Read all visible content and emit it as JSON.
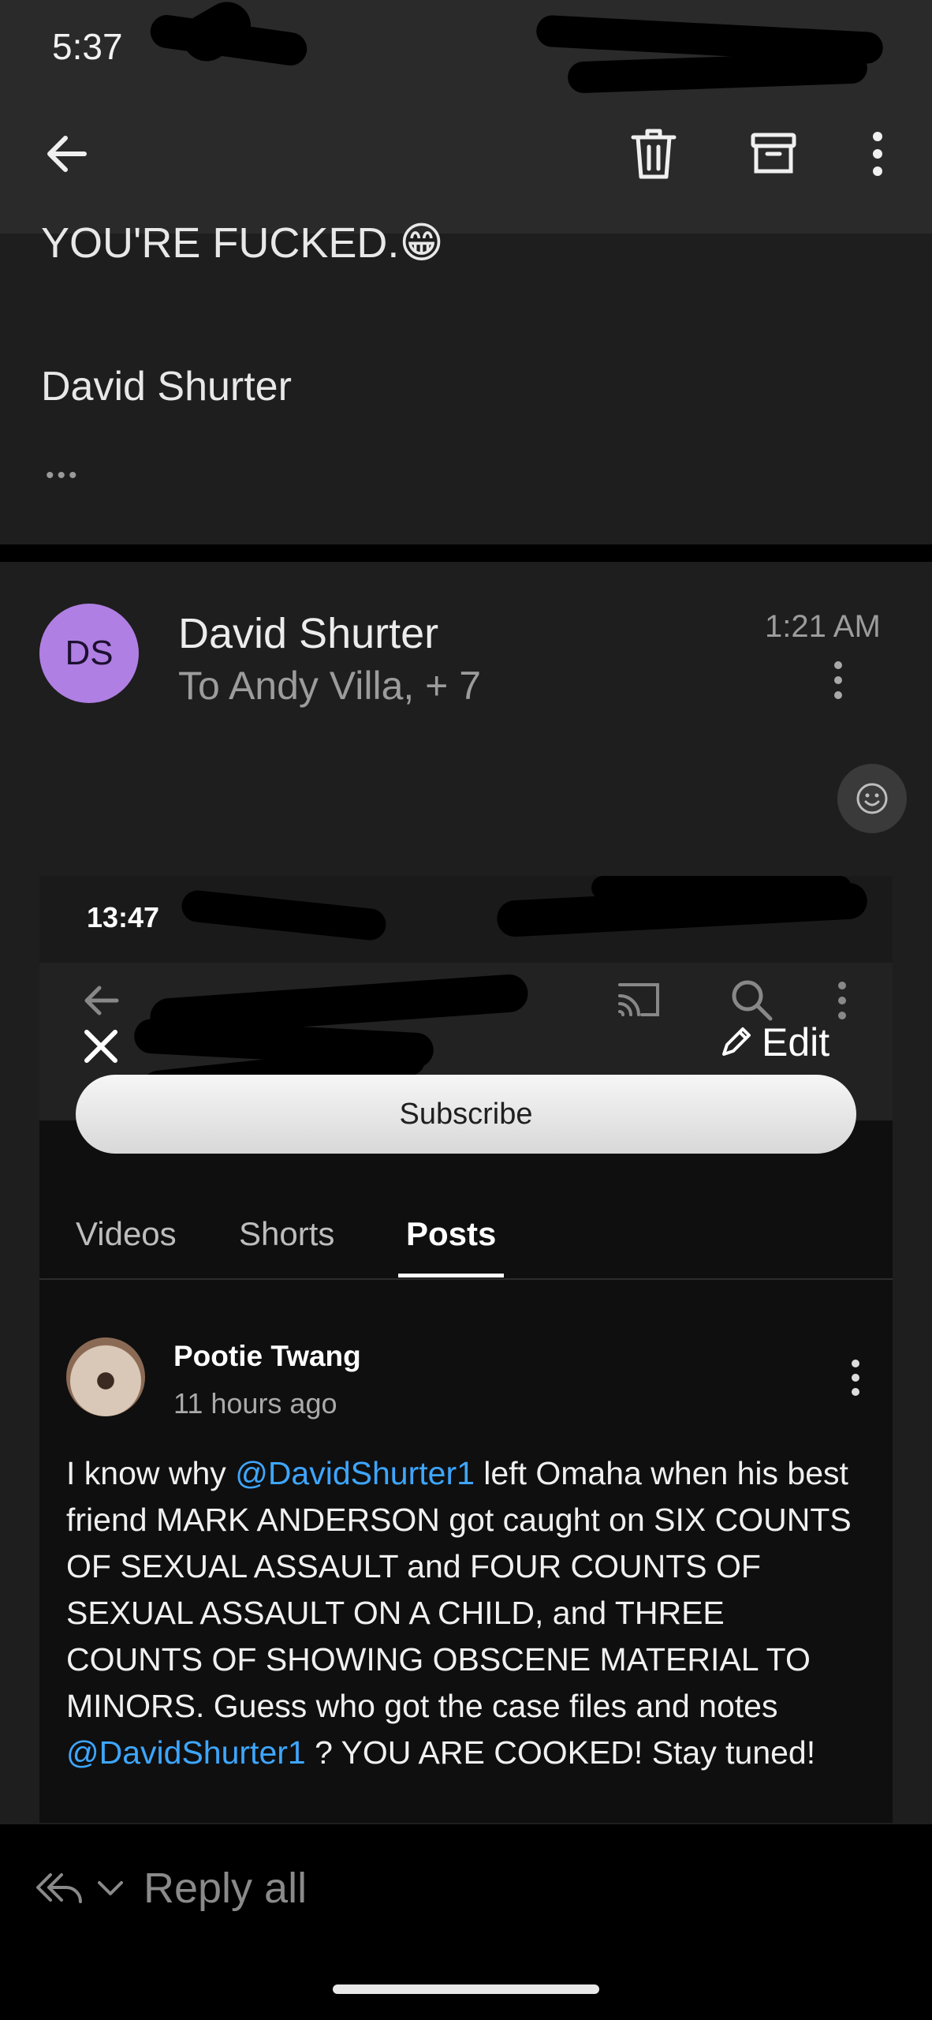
{
  "status_bar": {
    "time": "5:37"
  },
  "toolbar": {
    "back_icon": "arrow-left-icon",
    "delete_icon": "trash-icon",
    "archive_icon": "archive-icon",
    "more_icon": "more-vertical-icon"
  },
  "previous_message": {
    "text_line": "YOU'RE FUCKED.😁",
    "signature": "David Shurter",
    "expand_label": "•••"
  },
  "message": {
    "avatar_initials": "DS",
    "sender": "David Shurter",
    "recipients": "To Andy Villa, + 7",
    "time": "1:21 AM",
    "more_icon": "more-vertical-icon",
    "reaction_icon": "smiley-icon"
  },
  "embedded_screenshot": {
    "status_time": "13:47",
    "nav_icons": [
      "arrow-left-icon",
      "cast-icon",
      "search-icon",
      "more-vertical-icon"
    ],
    "close_icon": "close-icon",
    "edit_label": "Edit",
    "subscribe_label": "Subscribe",
    "tabs": [
      "Videos",
      "Shorts",
      "Posts"
    ],
    "active_tab": "Posts",
    "post": {
      "author": "Pootie Twang",
      "time_ago": "11 hours ago",
      "text_1": "I know why ",
      "mention_1": "@DavidShurter1",
      "text_2": " left Omaha when his best friend MARK ANDERSON got caught on SIX COUNTS OF SEXUAL ASSAULT and FOUR COUNTS OF SEXUAL ASSAULT ON A CHILD, and THREE COUNTS OF SHOWING OBSCENE MATERIAL TO MINORS. Guess who got the case files and notes ",
      "mention_2": "@DavidShurter1",
      "text_3": " ? YOU ARE COOKED! Stay tuned!"
    }
  },
  "bottom_bar": {
    "reply_all_label": "Reply all",
    "reply_all_icon": "reply-all-icon",
    "dropdown_icon": "chevron-down-icon"
  },
  "colors": {
    "avatar_bg": "#b07fe3",
    "mention": "#3ea6ff",
    "background": "#1e1e1e"
  }
}
